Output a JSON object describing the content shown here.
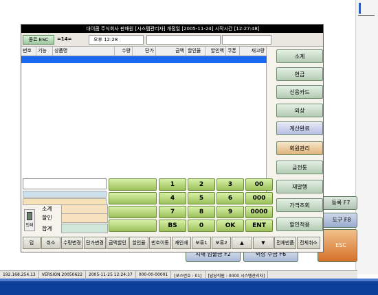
{
  "window_title": "대이콤 주식회사  판매원 [시스템관리자]  개점일 [2005-11-24]  시작시간 [12:27:48]",
  "info_bar": {
    "exit_label": "종료 ESC",
    "qty_label": "=14=",
    "time": "오후 12:28"
  },
  "table": {
    "columns": [
      "번호",
      "기능",
      "상품명",
      "수량",
      "단가",
      "금액",
      "할인율",
      "할인액",
      "쿠폰",
      "재고량"
    ]
  },
  "menu": {
    "items": [
      {
        "label": "소계",
        "style": "green"
      },
      {
        "label": "현금",
        "style": "green"
      },
      {
        "label": "신용카드",
        "style": "green"
      },
      {
        "label": "외상",
        "style": "green"
      },
      {
        "label": "계산완료",
        "style": "blue"
      },
      {
        "label": "회원관리",
        "style": "orange"
      },
      {
        "label": "금전통",
        "style": "green"
      },
      {
        "label": "재발행",
        "style": "green"
      },
      {
        "label": "가격조회",
        "style": "green"
      },
      {
        "label": "할인적용",
        "style": "green"
      }
    ]
  },
  "summary": {
    "print_label": "인쇄",
    "subtotal_label": "소계",
    "discount_label": "할인",
    "total_label": "합계",
    "subtotal_value": "",
    "discount_value": "",
    "total_value": ""
  },
  "keypad": {
    "keys": [
      "1",
      "2",
      "3",
      "00",
      "4",
      "5",
      "6",
      "000",
      "7",
      "8",
      "9",
      "0000",
      "BS",
      "0",
      "OK",
      "ENT"
    ]
  },
  "function_bar": {
    "buttons": [
      "덤",
      "취소",
      "수량변경",
      "단가변경",
      "금액할인",
      "할인율",
      "번호이동",
      "재인쇄",
      "보류1",
      "보류2",
      "▲",
      "▼",
      "전체반품",
      "전체취소"
    ]
  },
  "background": {
    "register_f7": "등록 F7",
    "tools_f8": "도구 F8",
    "cancel_esc": "ESC",
    "cash_f2": "시재 입출금 F2",
    "credit_f6": "외상 수금 F6"
  },
  "statusbar": {
    "ip": "192.168.254.13",
    "version": "VERSION 20050622",
    "datetime": "2005-11-25 12:24:37",
    "receipt_no": "000-00-00001",
    "pos_no": "[포스번호 : 01]",
    "staff": "[담당직원 : 0000 시스템관리자]"
  },
  "colors": {
    "selected_row": "#1a68f0",
    "keypad_green": "#9cc05a",
    "taskbar_blue": "#0c3f99"
  }
}
